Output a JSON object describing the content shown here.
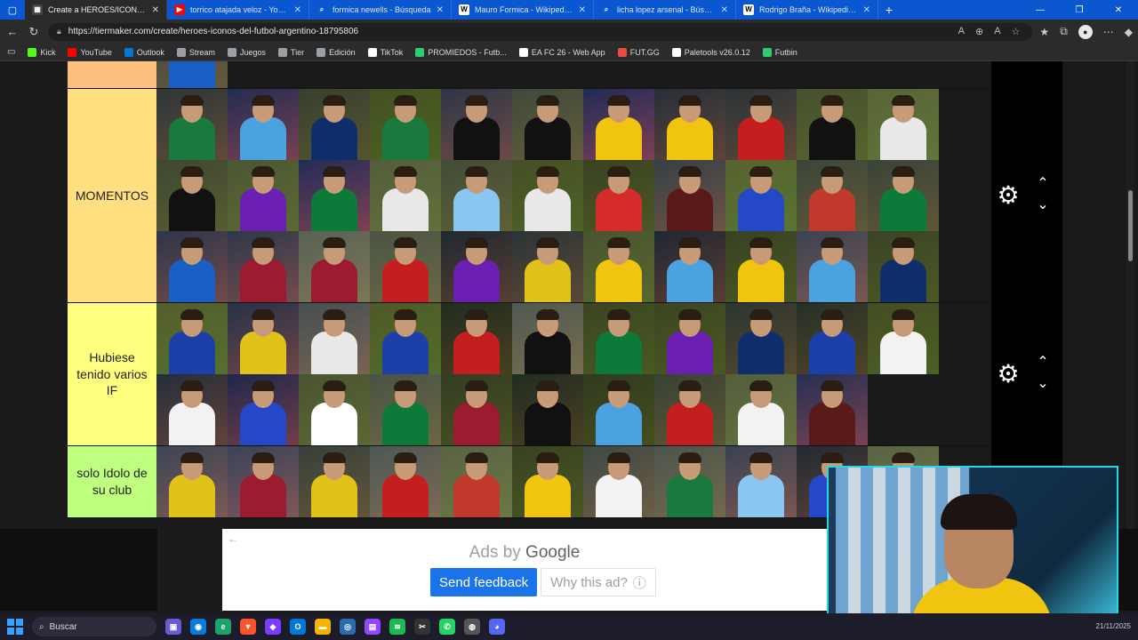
{
  "browser": {
    "tabs": [
      {
        "title": "Create a HEROES/ICONOS del FU",
        "favicon": "tiermaker-icon",
        "active": true,
        "color": "#444"
      },
      {
        "title": "torrico atajada veloz - YouTube",
        "favicon": "youtube-icon",
        "active": false,
        "color": "#ff0000"
      },
      {
        "title": "formica newells - Búsqueda",
        "favicon": "search-icon",
        "active": false,
        "color": "#0b57d0"
      },
      {
        "title": "Mauro Formica - Wikipedia, la enc",
        "favicon": "wikipedia-icon",
        "active": false,
        "color": "#ffffff"
      },
      {
        "title": "licha lopez arsenal - Búsqueda",
        "favicon": "search-icon",
        "active": false,
        "color": "#0b57d0"
      },
      {
        "title": "Rodrigo Braña - Wikipedia, la enc",
        "favicon": "wikipedia-icon",
        "active": false,
        "color": "#ffffff"
      }
    ],
    "url": "https://tiermaker.com/create/heroes-iconos-del-futbol-argentino-18795806",
    "bookmarks": [
      {
        "label": "Kick",
        "color": "#53fc18"
      },
      {
        "label": "YouTube",
        "color": "#ff0000"
      },
      {
        "label": "Outlook",
        "color": "#0078d4"
      },
      {
        "label": "Stream",
        "color": "#9aa0a6"
      },
      {
        "label": "Juegos",
        "color": "#9aa0a6"
      },
      {
        "label": "Tier",
        "color": "#9aa0a6"
      },
      {
        "label": "Edición",
        "color": "#9aa0a6"
      },
      {
        "label": "TikTok",
        "color": "#ffffff"
      },
      {
        "label": "PROMIEDOS - Futb...",
        "color": "#2ecc71"
      },
      {
        "label": "EA FC 26 - Web App",
        "color": "#ffffff"
      },
      {
        "label": "FUT.GG",
        "color": "#e74c3c"
      },
      {
        "label": "Paletools v26.0.12",
        "color": "#ffffff"
      },
      {
        "label": "Futbin",
        "color": "#2ecc71"
      }
    ]
  },
  "tiers": [
    {
      "label": "",
      "color": "#ffbf7f",
      "count": 1
    },
    {
      "label": "MOMENTOS",
      "color": "#ffdf80",
      "count": 33
    },
    {
      "label": "Hubiese tenido varios IF",
      "color": "#ffff7f",
      "count": 21
    },
    {
      "label": "solo Idolo de su club",
      "color": "#bfff7f",
      "count": 11
    }
  ],
  "controls": {
    "gear_icon": "⚙",
    "up_icon": "⌃",
    "down_icon": "⌄"
  },
  "ad": {
    "back": "←",
    "ads_by": "Ads by",
    "google": "Google",
    "send_feedback": "Send feedback",
    "why_this_ad": "Why this ad?",
    "info_icon": "ⓘ"
  },
  "taskbar": {
    "search_placeholder": "Buscar",
    "date": "21/11/2025"
  }
}
